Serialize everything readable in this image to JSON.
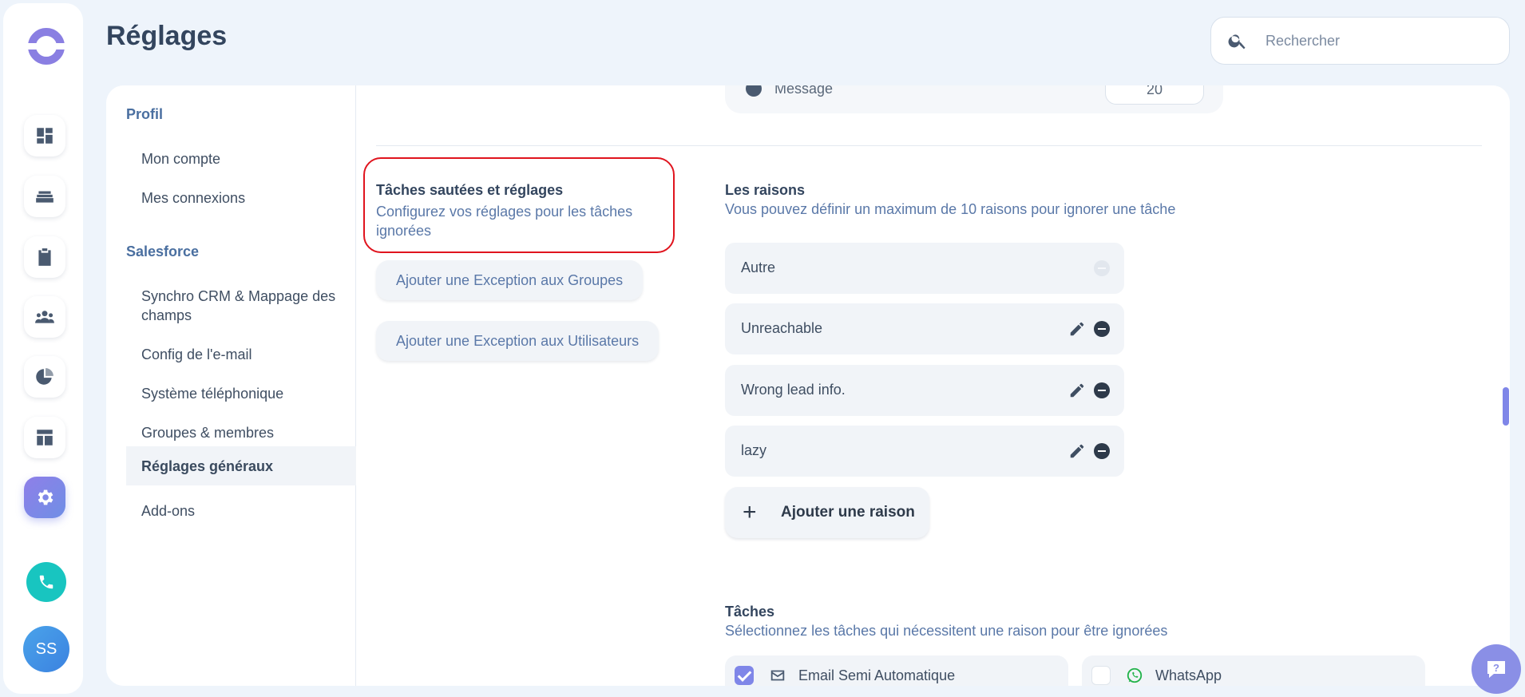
{
  "header": {
    "title": "Réglages",
    "search_placeholder": "Rechercher"
  },
  "rail": {
    "avatar_initials": "SS"
  },
  "settings_nav": {
    "groups": [
      {
        "label": "Profil",
        "items": [
          "Mon compte",
          "Mes connexions"
        ]
      },
      {
        "label": "Salesforce",
        "items": [
          "Synchro CRM & Mappage des champs",
          "Config de l'e-mail",
          "Système téléphonique",
          "Groupes & membres",
          "Réglages généraux",
          "Add-ons"
        ]
      }
    ],
    "active_item": "Réglages généraux"
  },
  "top_remnant": {
    "label": "Message",
    "value": "20"
  },
  "skipped_tasks": {
    "title": "Tâches sautées et réglages",
    "description": "Configurez vos réglages pour les tâches ignorées",
    "buttons": [
      "Ajouter une Exception aux Groupes",
      "Ajouter une Exception aux Utilisateurs"
    ]
  },
  "reasons": {
    "title": "Les raisons",
    "description": "Vous pouvez définir un maximum de 10 raisons pour ignorer une tâche",
    "items": [
      "Autre",
      "Unreachable",
      "Wrong lead info.",
      "lazy"
    ],
    "add_label": "Ajouter une raison"
  },
  "tasks": {
    "title": "Tâches",
    "description": "Sélectionnez les tâches qui nécessitent une raison pour être ignorées",
    "items": [
      {
        "label": "Email Semi Automatique",
        "checked": true,
        "icon": "mail-icon"
      },
      {
        "label": "WhatsApp",
        "checked": false,
        "icon": "whatsapp-icon"
      }
    ]
  },
  "colors": {
    "accent": "#7f86e8",
    "highlight_border": "#e0141e",
    "phone": "#18c5c0"
  }
}
